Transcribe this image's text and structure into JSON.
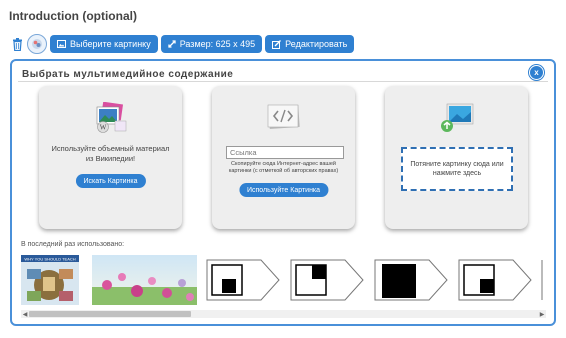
{
  "section": {
    "title": "Introduction (optional)"
  },
  "toolbar": {
    "choose_image": "Выберите картинку",
    "size": "Размер: 625 x 495",
    "edit": "Редактировать"
  },
  "dialog": {
    "title": "Выбрать мультимедийное содержание",
    "close_label": "x",
    "wiki": {
      "description": "Используйте объемный материал из Википедии!",
      "button": "Искать Картинка"
    },
    "link": {
      "placeholder": "Ссылка",
      "hint": "Скопируйте сюда Интернет-адрес вашей картинки (с отметкой об авторских правах)",
      "button": "Используйте Картинка"
    },
    "upload": {
      "dropzone": "Потяните картинку сюда или нажмите здесь"
    },
    "recent_label": "В последний раз использовано:"
  },
  "recent_items": [
    {
      "kind": "photo-collage"
    },
    {
      "kind": "flowers-photo"
    },
    {
      "kind": "arrow-shape",
      "square": "small-bottom-left"
    },
    {
      "kind": "arrow-shape",
      "square": "small-top-right"
    },
    {
      "kind": "arrow-shape",
      "square": "large-center"
    },
    {
      "kind": "arrow-shape",
      "square": "small-bottom-right"
    }
  ],
  "colors": {
    "accent": "#2f80d1",
    "dialog_border": "#4a90d9",
    "card_bg": "#eeeeee"
  }
}
